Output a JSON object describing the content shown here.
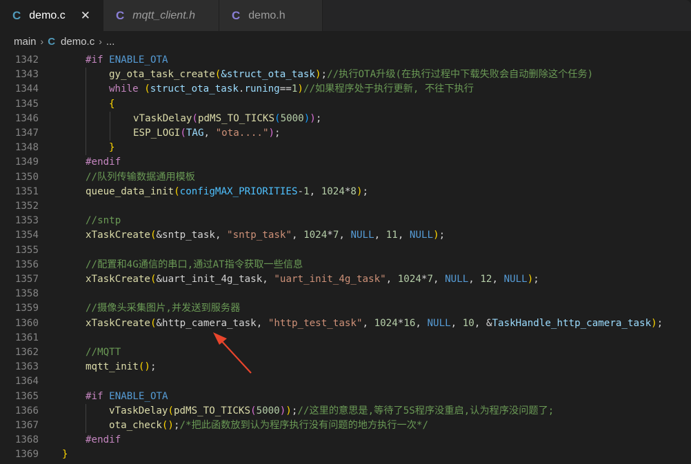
{
  "tabs": [
    {
      "icon": "C",
      "label": "demo.c",
      "close": "✕"
    },
    {
      "icon": "C",
      "label": "mqtt_client.h"
    },
    {
      "icon": "C",
      "label": "demo.h"
    }
  ],
  "breadcrumb": {
    "folder": "main",
    "icon": "C",
    "file": "demo.c",
    "more": "..."
  },
  "lines": [
    {
      "n": "1342",
      "segs": [
        [
          "#if ",
          "kw"
        ],
        [
          "ENABLE_OTA",
          "mac"
        ]
      ]
    },
    {
      "n": "1343",
      "segs": [
        [
          "gy_ota_task_create",
          "fn"
        ],
        [
          "(",
          "br1"
        ],
        [
          "&struct_ota_task",
          "var"
        ],
        [
          ")",
          "br1"
        ],
        [
          ";",
          ""
        ],
        [
          "//执行OTA升级(在执行过程中下载失败会自动删除这个任务)",
          "cm"
        ]
      ]
    },
    {
      "n": "1344",
      "segs": [
        [
          "while ",
          "kw"
        ],
        [
          "(",
          "br1"
        ],
        [
          "struct_ota_task",
          "var"
        ],
        [
          ".",
          ""
        ],
        [
          "runing",
          "var"
        ],
        [
          "==",
          ""
        ],
        [
          "1",
          "num"
        ],
        [
          ")",
          "br1"
        ],
        [
          "//如果程序处于执行更新, 不往下执行",
          "cm"
        ]
      ]
    },
    {
      "n": "1345",
      "segs": [
        [
          "{",
          "br1"
        ]
      ]
    },
    {
      "n": "1346",
      "segs": [
        [
          "vTaskDelay",
          "fn"
        ],
        [
          "(",
          "br2"
        ],
        [
          "pdMS_TO_TICKS",
          "fn"
        ],
        [
          "(",
          "br3"
        ],
        [
          "5000",
          "num"
        ],
        [
          ")",
          "br3"
        ],
        [
          ")",
          "br2"
        ],
        [
          ";",
          ""
        ]
      ]
    },
    {
      "n": "1347",
      "segs": [
        [
          "ESP_LOGI",
          "fn"
        ],
        [
          "(",
          "br2"
        ],
        [
          "TAG",
          "var"
        ],
        [
          ", ",
          ""
        ],
        [
          "\"ota....\"",
          "str"
        ],
        [
          ")",
          "br2"
        ],
        [
          ";",
          ""
        ]
      ]
    },
    {
      "n": "1348",
      "segs": [
        [
          "}",
          "br1"
        ]
      ]
    },
    {
      "n": "1349",
      "segs": [
        [
          "#endif",
          "kw"
        ]
      ]
    },
    {
      "n": "1350",
      "segs": [
        [
          "//队列传输数据通用模板",
          "cm"
        ]
      ]
    },
    {
      "n": "1351",
      "segs": [
        [
          "queue_data_init",
          "fn"
        ],
        [
          "(",
          "br1"
        ],
        [
          "configMAX_PRIORITIES",
          "con"
        ],
        [
          "-",
          ""
        ],
        [
          "1",
          "num"
        ],
        [
          ", ",
          ""
        ],
        [
          "1024",
          "num"
        ],
        [
          "*",
          ""
        ],
        [
          "8",
          "num"
        ],
        [
          ")",
          "br1"
        ],
        [
          ";",
          ""
        ]
      ]
    },
    {
      "n": "1352",
      "segs": []
    },
    {
      "n": "1353",
      "segs": [
        [
          "//sntp",
          "cm"
        ]
      ]
    },
    {
      "n": "1354",
      "segs": [
        [
          "xTaskCreate",
          "fn"
        ],
        [
          "(",
          "br1"
        ],
        [
          "&sntp_task",
          ""
        ],
        [
          ", ",
          ""
        ],
        [
          "\"sntp_task\"",
          "str"
        ],
        [
          ", ",
          ""
        ],
        [
          "1024",
          "num"
        ],
        [
          "*",
          ""
        ],
        [
          "7",
          "num"
        ],
        [
          ", ",
          ""
        ],
        [
          "NULL",
          "nul"
        ],
        [
          ", ",
          ""
        ],
        [
          "11",
          "num"
        ],
        [
          ", ",
          ""
        ],
        [
          "NULL",
          "nul"
        ],
        [
          ")",
          "br1"
        ],
        [
          ";",
          ""
        ]
      ]
    },
    {
      "n": "1355",
      "segs": []
    },
    {
      "n": "1356",
      "segs": [
        [
          "//配置和4G通信的串口,通过AT指令获取一些信息",
          "cm"
        ]
      ]
    },
    {
      "n": "1357",
      "segs": [
        [
          "xTaskCreate",
          "fn"
        ],
        [
          "(",
          "br1"
        ],
        [
          "&uart_init_4g_task",
          ""
        ],
        [
          ", ",
          ""
        ],
        [
          "\"uart_init_4g_task\"",
          "str"
        ],
        [
          ", ",
          ""
        ],
        [
          "1024",
          "num"
        ],
        [
          "*",
          ""
        ],
        [
          "7",
          "num"
        ],
        [
          ", ",
          ""
        ],
        [
          "NULL",
          "nul"
        ],
        [
          ", ",
          ""
        ],
        [
          "12",
          "num"
        ],
        [
          ", ",
          ""
        ],
        [
          "NULL",
          "nul"
        ],
        [
          ")",
          "br1"
        ],
        [
          ";",
          ""
        ]
      ]
    },
    {
      "n": "1358",
      "segs": []
    },
    {
      "n": "1359",
      "segs": [
        [
          "//摄像头采集图片,并发送到服务器",
          "cm"
        ]
      ]
    },
    {
      "n": "1360",
      "segs": [
        [
          "xTaskCreate",
          "fn"
        ],
        [
          "(",
          "br1"
        ],
        [
          "&http_camera_task",
          ""
        ],
        [
          ", ",
          ""
        ],
        [
          "\"http_test_task\"",
          "str"
        ],
        [
          ", ",
          ""
        ],
        [
          "1024",
          "num"
        ],
        [
          "*",
          ""
        ],
        [
          "16",
          "num"
        ],
        [
          ", ",
          ""
        ],
        [
          "NULL",
          "nul"
        ],
        [
          ", ",
          ""
        ],
        [
          "10",
          "num"
        ],
        [
          ", ",
          ""
        ],
        [
          "&",
          ""
        ],
        [
          "TaskHandle_http_camera_task",
          "var"
        ],
        [
          ")",
          "br1"
        ],
        [
          ";",
          ""
        ]
      ]
    },
    {
      "n": "1361",
      "segs": []
    },
    {
      "n": "1362",
      "segs": [
        [
          "//MQTT",
          "cm"
        ]
      ]
    },
    {
      "n": "1363",
      "segs": [
        [
          "mqtt_init",
          "fn"
        ],
        [
          "()",
          "br1"
        ],
        [
          ";",
          ""
        ]
      ]
    },
    {
      "n": "1364",
      "segs": []
    },
    {
      "n": "1365",
      "segs": [
        [
          "#if ",
          "kw"
        ],
        [
          "ENABLE_OTA",
          "mac"
        ]
      ]
    },
    {
      "n": "1366",
      "segs": [
        [
          "vTaskDelay",
          "fn"
        ],
        [
          "(",
          "br1"
        ],
        [
          "pdMS_TO_TICKS",
          "fn"
        ],
        [
          "(",
          "br2"
        ],
        [
          "5000",
          "num"
        ],
        [
          ")",
          "br2"
        ],
        [
          ")",
          "br1"
        ],
        [
          ";",
          ""
        ],
        [
          "//这里的意思是,等待了5S程序没重启,认为程序没问题了;",
          "cm"
        ]
      ]
    },
    {
      "n": "1367",
      "segs": [
        [
          "ota_check",
          "fn"
        ],
        [
          "()",
          "br1"
        ],
        [
          ";",
          ""
        ],
        [
          "/*把此函数放到认为程序执行没有问题的地方执行一次*/",
          "cm"
        ]
      ]
    },
    {
      "n": "1368",
      "segs": [
        [
          "#endif",
          "kw"
        ]
      ]
    },
    {
      "n": "1369",
      "segs": [
        [
          "}",
          "br1"
        ]
      ]
    }
  ],
  "colors": {
    "arrow": "#e8452c",
    "accent_c_icon": "#519aba"
  }
}
